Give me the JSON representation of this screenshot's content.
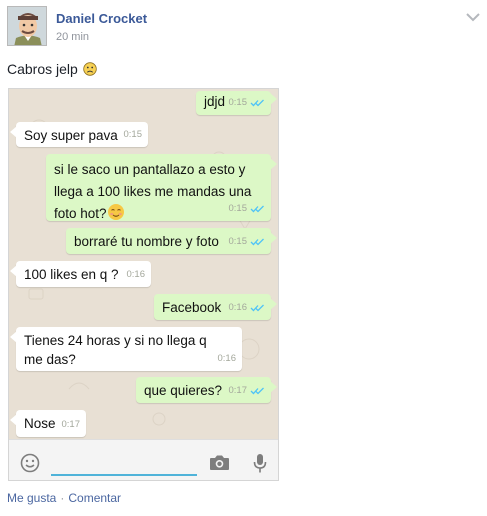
{
  "post": {
    "author": "Daniel Crocket",
    "time": "20 min",
    "caption": "Cabros jelp",
    "caption_emoji": "frowning-face-icon",
    "menu_icon": "chevron-down-icon"
  },
  "chat": {
    "messages": [
      {
        "side": "out",
        "text": "jdjd",
        "time": "0:15",
        "ticks": "double-check-blue"
      },
      {
        "side": "in",
        "text": "Soy super pava",
        "time": "0:15"
      },
      {
        "side": "out",
        "text": "si le saco un pantallazo a esto y llega a 100 likes me mandas una foto hot?",
        "emoji": "smiling-face-icon",
        "time": "0:15",
        "ticks": "double-check-blue"
      },
      {
        "side": "out",
        "text": "borraré tu nombre y foto",
        "time": "0:15",
        "ticks": "double-check-blue"
      },
      {
        "side": "in",
        "text": "100 likes en q ?",
        "time": "0:16"
      },
      {
        "side": "out",
        "text": "Facebook",
        "time": "0:16",
        "ticks": "double-check-blue"
      },
      {
        "side": "in",
        "text": "Tienes 24 horas y si no llega q me das?",
        "time": "0:16"
      },
      {
        "side": "out",
        "text": "que quieres?",
        "time": "0:17",
        "ticks": "double-check-blue"
      },
      {
        "side": "in",
        "text": "Nose",
        "time": "0:17"
      }
    ],
    "input": {
      "value": "",
      "emoji_icon": "smile-icon",
      "camera_icon": "camera-icon",
      "mic_icon": "microphone-icon"
    },
    "colors": {
      "incoming": "#ffffff",
      "outgoing": "#dcf8c6",
      "background": "#e8e0d4",
      "ticks": "#4fc3f7"
    }
  },
  "actions": {
    "like": "Me gusta",
    "separator": "·",
    "comment": "Comentar"
  },
  "colors": {
    "link": "#3b5998",
    "muted": "#90949c"
  }
}
